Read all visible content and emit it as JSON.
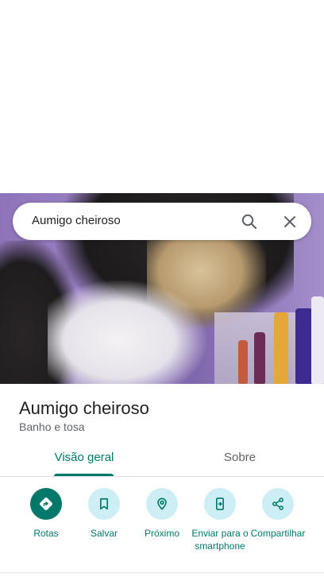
{
  "search": {
    "query": "Aumigo cheiroso",
    "search_icon": "search-icon",
    "close_icon": "close-icon"
  },
  "place": {
    "name": "Aumigo cheiroso",
    "category": "Banho e tosa"
  },
  "tabs": [
    {
      "label": "Visão geral",
      "active": true
    },
    {
      "label": "Sobre",
      "active": false
    }
  ],
  "actions": [
    {
      "label": "Rotas",
      "icon": "directions-icon"
    },
    {
      "label": "Salvar",
      "icon": "bookmark-icon"
    },
    {
      "label": "Próximo",
      "icon": "nearby-icon"
    },
    {
      "label": "Enviar para o smartphone",
      "icon": "send-to-phone-icon"
    },
    {
      "label": "Compartilhar",
      "icon": "share-icon"
    }
  ],
  "colors": {
    "accent": "#00796b",
    "action_bg": "#cdeef5",
    "primary_action": "#00796b"
  }
}
